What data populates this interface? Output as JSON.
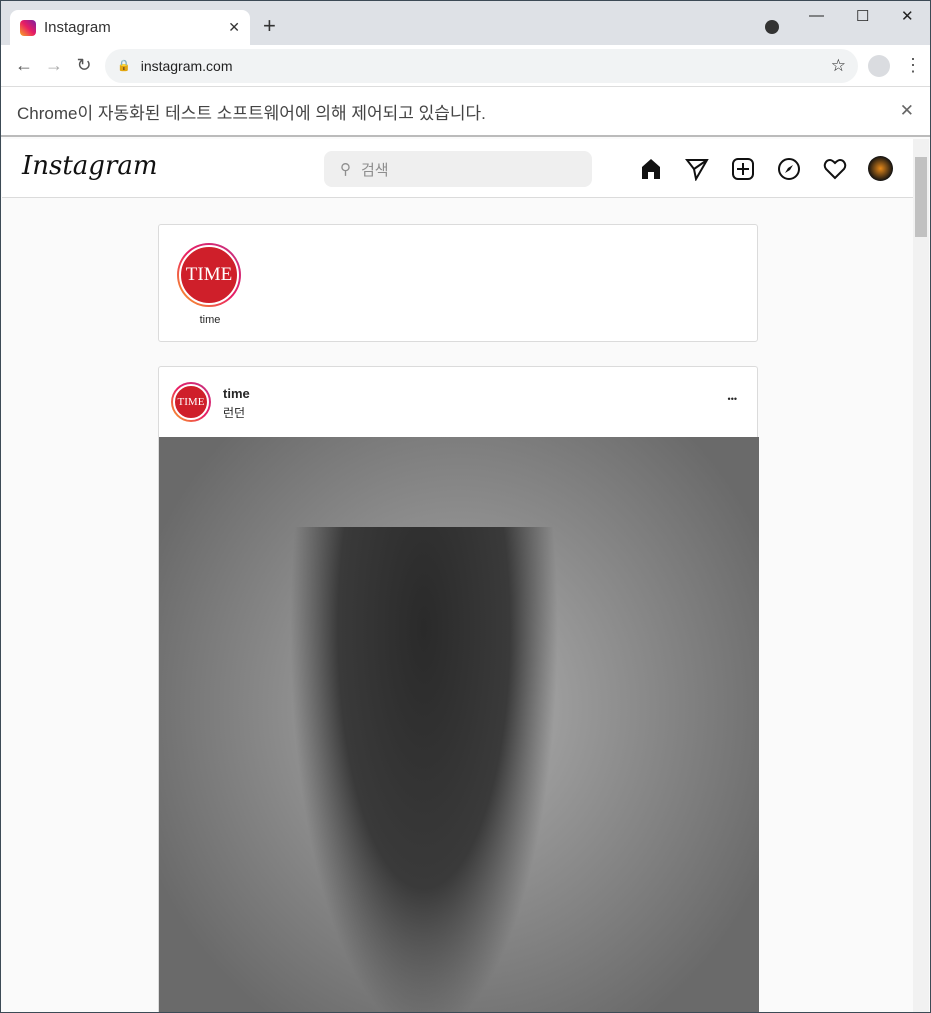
{
  "browser": {
    "tab_title": "Instagram",
    "url": "instagram.com",
    "infobar": "Chrome이 자동화된 테스트 소프트웨어에 의해 제어되고 있습니다."
  },
  "nav": {
    "logo": "Instagram",
    "search_placeholder": "검색"
  },
  "stories": [
    {
      "name": "time",
      "logo": "TIME"
    }
  ],
  "post": {
    "user": "time",
    "location": "런던",
    "logo": "TIME",
    "more": "•••"
  }
}
